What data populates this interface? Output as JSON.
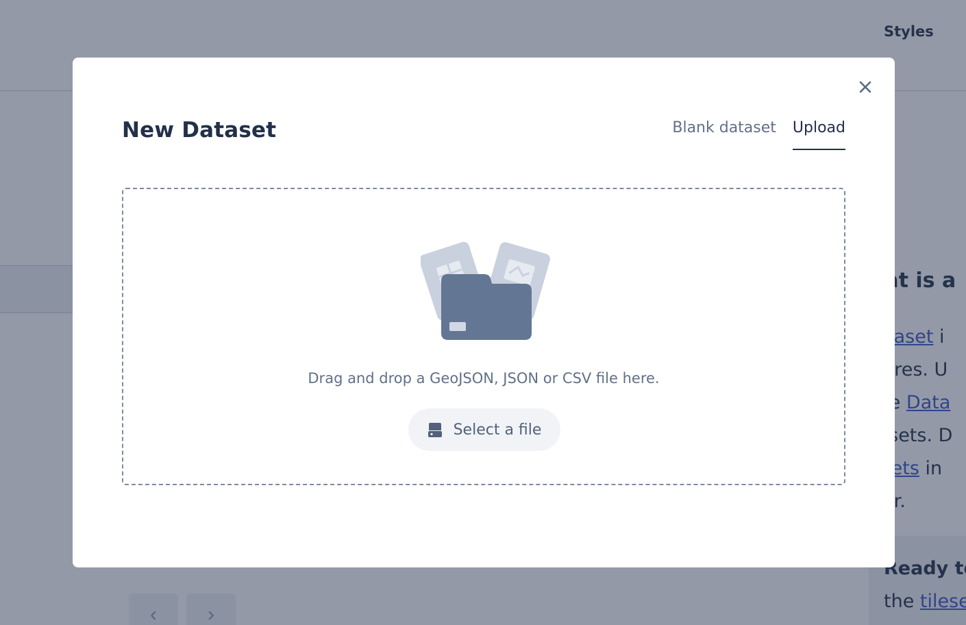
{
  "background": {
    "header_label": "Styles",
    "side_heading": "hat is a",
    "side_lines": [
      {
        "text": "",
        "link": "lataset",
        "after": " i"
      },
      {
        "text": "itures. U",
        "link": "",
        "after": ""
      },
      {
        "text": "the ",
        "link": "Data",
        "after": ""
      },
      {
        "text": "tasets. D",
        "link": "",
        "after": ""
      },
      {
        "text": "",
        "link": "esets",
        "after": " in"
      },
      {
        "text": "itor.",
        "link": "",
        "after": ""
      }
    ],
    "ready_heading": "Ready to",
    "ready_line_prefix": "the ",
    "ready_line_link": "tilese",
    "pager_prev": "‹",
    "pager_next": "›"
  },
  "modal": {
    "title": "New Dataset",
    "close_icon": "close-icon",
    "tabs": [
      {
        "label": "Blank dataset",
        "active": false
      },
      {
        "label": "Upload",
        "active": true
      }
    ],
    "dropzone": {
      "instruction": "Drag and drop a GeoJSON, JSON or CSV file here.",
      "select_button_label": "Select a file",
      "select_button_icon": "drive-icon"
    }
  },
  "colors": {
    "title": "#22304a",
    "muted_text": "#607088",
    "folder": "#637794",
    "doc_cards": "#c9d1de",
    "overlay": "rgba(40,52,78,0.5)"
  }
}
